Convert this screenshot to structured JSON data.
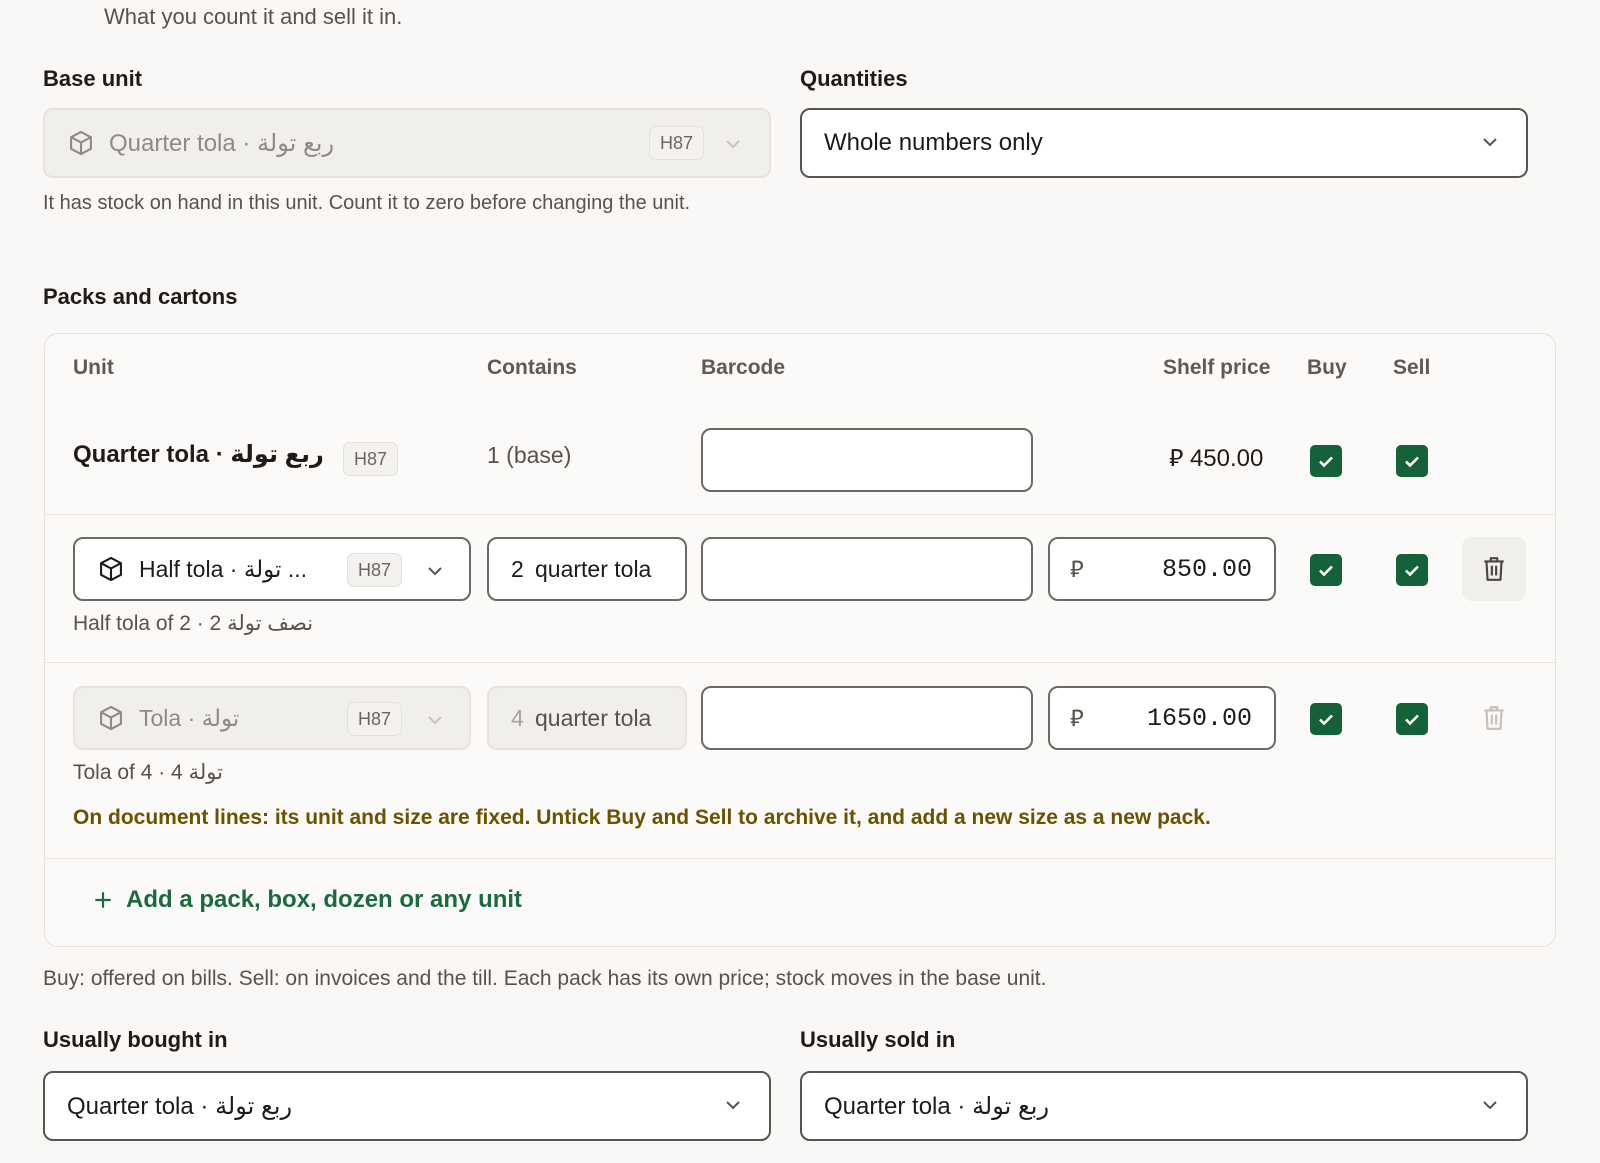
{
  "top_hint": "What you count it and sell it in.",
  "base_unit": {
    "label": "Base unit",
    "value": "Quarter tola · ربع تولة",
    "code": "H87",
    "help": "It has stock on hand in this unit. Count it to zero before changing the unit."
  },
  "quantities": {
    "label": "Quantities",
    "value": "Whole numbers only"
  },
  "packs": {
    "section_label": "Packs and cartons",
    "columns": {
      "unit": "Unit",
      "contains": "Contains",
      "barcode": "Barcode",
      "shelf_price": "Shelf price",
      "buy": "Buy",
      "sell": "Sell"
    },
    "base_row": {
      "unit": "Quarter tola · ربع تولة",
      "code": "H87",
      "contains": "1 (base)",
      "barcode": "",
      "currency": "⃁",
      "price": "450.00",
      "buy": true,
      "sell": true
    },
    "rows": [
      {
        "unit": "Half tola · تولة ...",
        "code": "H87",
        "qty": "2",
        "qty_unit": "quarter tola",
        "barcode": "",
        "currency": "⃁",
        "price": "850.00",
        "buy": true,
        "sell": true,
        "caption": "Half tola of 2 · 2 نصف تولة"
      },
      {
        "unit": "Tola · تولة",
        "code": "H87",
        "qty": "4",
        "qty_unit": "quarter tola",
        "barcode": "",
        "currency": "⃁",
        "price": "1650.00",
        "buy": true,
        "sell": true,
        "caption": "Tola of 4 · 4 تولة",
        "warning": "On document lines: its unit and size are fixed. Untick Buy and Sell to archive it, and add a new size as a new pack."
      }
    ],
    "add_label": "Add a pack, box, dozen or any unit",
    "footnote": "Buy: offered on bills. Sell: on invoices and the till. Each pack has its own price; stock moves in the base unit."
  },
  "usually_bought": {
    "label": "Usually bought in",
    "value": "Quarter tola · ربع تولة"
  },
  "usually_sold": {
    "label": "Usually sold in",
    "value": "Quarter tola · ربع تولة"
  },
  "colors": {
    "accent_green": "#15613a",
    "warning_text": "#6b5200"
  }
}
